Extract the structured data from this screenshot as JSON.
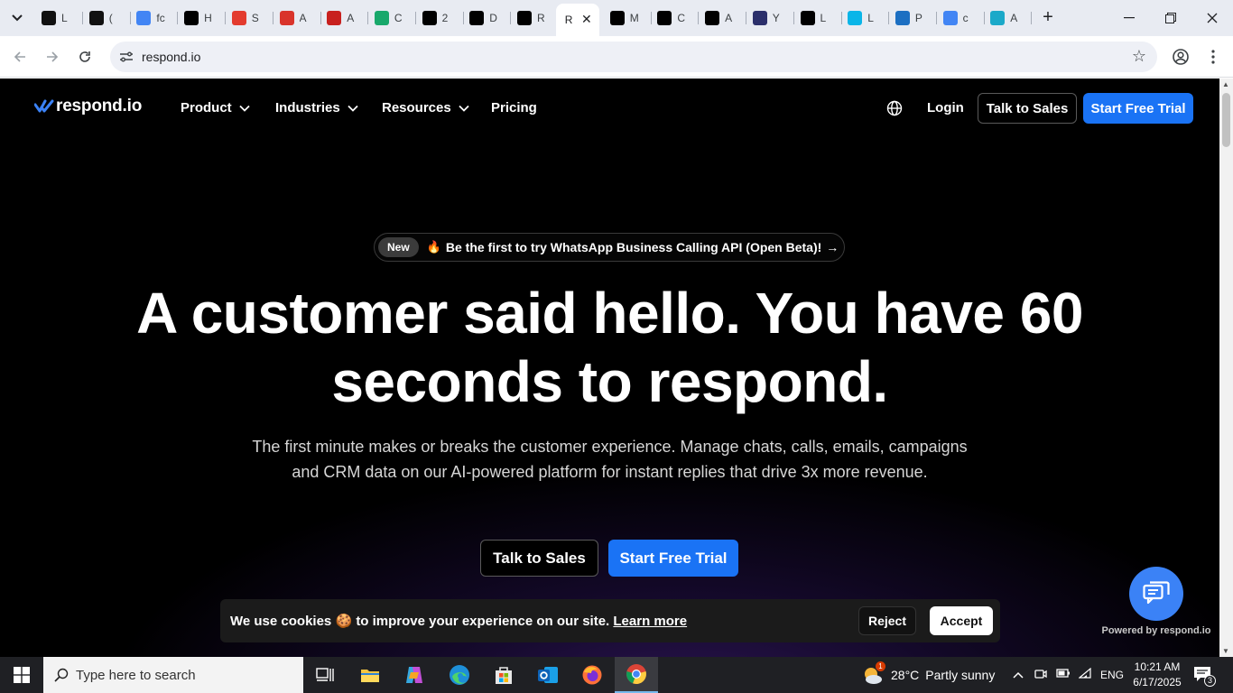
{
  "browser": {
    "tabs": [
      {
        "title": "L",
        "icon": "threads-icon",
        "color": "#111111"
      },
      {
        "title": "(",
        "icon": "medium-icon",
        "color": "#111111"
      },
      {
        "title": "fc",
        "icon": "google-icon",
        "color": "#4285f4"
      },
      {
        "title": "H",
        "icon": "bold-b-icon",
        "color": "#000000"
      },
      {
        "title": "S",
        "icon": "x-cross-icon",
        "color": "#e33b2e"
      },
      {
        "title": "A",
        "icon": "sgt-icon",
        "color": "#d9342b"
      },
      {
        "title": "A",
        "icon": "fx-icon",
        "color": "#c8201e"
      },
      {
        "title": "C",
        "icon": "s-icon",
        "color": "#18a86b"
      },
      {
        "title": "2",
        "icon": "a-icon",
        "color": "#000000"
      },
      {
        "title": "D",
        "icon": "a-icon",
        "color": "#000000"
      },
      {
        "title": "R",
        "icon": "a-icon",
        "color": "#000000"
      },
      {
        "title": "R",
        "icon": "respond-icon",
        "color": "#000000"
      },
      {
        "title": "M",
        "icon": "a-icon",
        "color": "#000000"
      },
      {
        "title": "C",
        "icon": "m-icon",
        "color": "#000000"
      },
      {
        "title": "A",
        "icon": "a-icon",
        "color": "#000000"
      },
      {
        "title": "Y",
        "icon": "cube-icon",
        "color": "#2b2f6b"
      },
      {
        "title": "L",
        "icon": "a-icon",
        "color": "#000000"
      },
      {
        "title": "L",
        "icon": "arrows-icon",
        "color": "#0ab5e8"
      },
      {
        "title": "P",
        "icon": "xf-icon",
        "color": "#1c6fc2"
      },
      {
        "title": "c",
        "icon": "google-icon",
        "color": "#4285f4"
      },
      {
        "title": "A",
        "icon": "grid-icon",
        "color": "#1ba9c9"
      }
    ],
    "active_tab_index": 11,
    "url": "respond.io"
  },
  "site": {
    "logo_text": "respond.io",
    "nav": {
      "product": "Product",
      "industries": "Industries",
      "resources": "Resources",
      "pricing": "Pricing",
      "login": "Login",
      "talk_to_sales": "Talk to Sales",
      "start_free_trial": "Start Free Trial"
    },
    "announcement": {
      "badge": "New",
      "emoji": "🔥",
      "text": "Be the first to try WhatsApp Business Calling API (Open Beta)!",
      "arrow": "→"
    },
    "hero": {
      "title": "A customer said hello. You have 60 seconds to respond.",
      "subtitle": "The first minute makes or breaks the customer experience. Manage chats, calls, emails, campaigns and CRM data on our AI-powered platform for instant replies that drive 3x more revenue.",
      "cta_secondary": "Talk to Sales",
      "cta_primary": "Start Free Trial"
    },
    "cookie": {
      "text_before": "We use cookies",
      "emoji": "🍪",
      "text_after": "to improve your experience on our site.",
      "link": "Learn more",
      "reject": "Reject",
      "accept": "Accept"
    },
    "chat_widget": {
      "powered_by": "Powered by respond.io"
    },
    "colors": {
      "primary": "#1a73f5",
      "background": "#000000"
    }
  },
  "taskbar": {
    "search_placeholder": "Type here to search",
    "weather": {
      "temp": "28°C",
      "condition": "Partly sunny",
      "badge": "1"
    },
    "language": "ENG",
    "time": "10:21 AM",
    "date": "6/17/2025",
    "notification_count": "3"
  }
}
